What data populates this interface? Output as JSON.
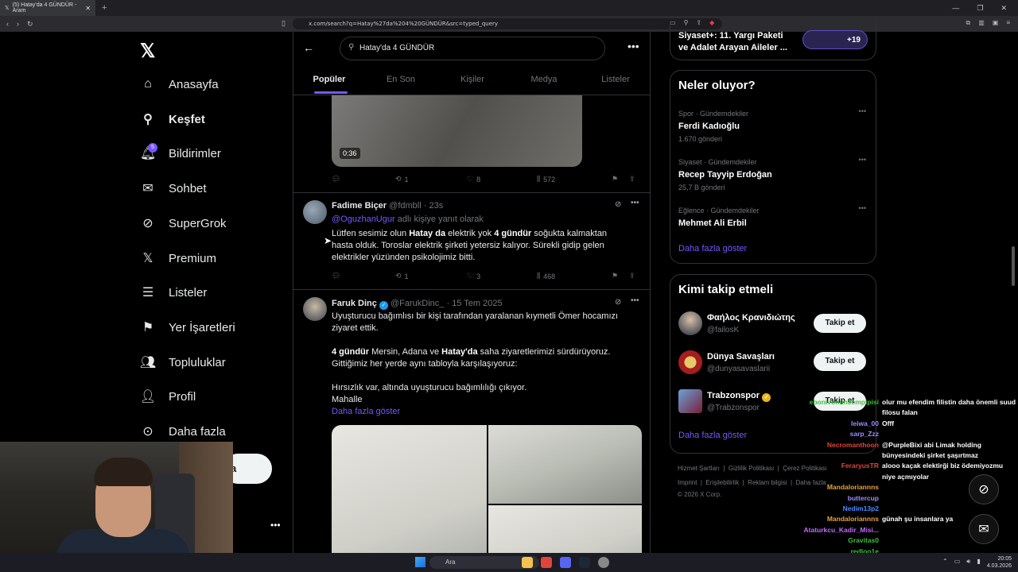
{
  "browser": {
    "tab_title": "(5) Hatay'da 4 GÜNDÜR - Aram",
    "url": "x.com/search?q=Hatay%27da%204%20GÜNDÜR&src=typed_query"
  },
  "nav": {
    "items": [
      {
        "label": "Anasayfa",
        "icon": "home-icon"
      },
      {
        "label": "Keşfet",
        "icon": "search-icon"
      },
      {
        "label": "Bildirimler",
        "icon": "bell-icon"
      },
      {
        "label": "Sohbet",
        "icon": "mail-icon"
      },
      {
        "label": "SuperGrok",
        "icon": "grok-icon"
      },
      {
        "label": "Premium",
        "icon": "x-icon"
      },
      {
        "label": "Listeler",
        "icon": "list-icon"
      },
      {
        "label": "Yer İşaretleri",
        "icon": "bookmark-icon"
      },
      {
        "label": "Topluluklar",
        "icon": "people-icon"
      },
      {
        "label": "Profil",
        "icon": "person-icon"
      },
      {
        "label": "Daha fazla",
        "icon": "more-icon"
      }
    ],
    "notif_badge": "5",
    "post_btn_fragment": "a"
  },
  "search": {
    "query": "Hatay'da 4 GÜNDÜR",
    "tabs": [
      "Popüler",
      "En Son",
      "Kişiler",
      "Medya",
      "Listeler"
    ]
  },
  "tweet1": {
    "video_duration": "0:36",
    "retweets": "1",
    "likes": "8",
    "views": "572"
  },
  "tweet2": {
    "name": "Fadime Biçer",
    "handle": "@fdmbll",
    "time": "· 23s",
    "reply_to": "@OguzhanUgur",
    "reply_suffix": " adlı kişiye yanıt olarak",
    "text_a": "Lütfen sesimiz olun ",
    "text_b": "Hatay da",
    "text_c": " elektrik yok ",
    "text_d": "4 gündür",
    "text_e": " soğukta kalmaktan hasta olduk. Toroslar elektrik şirketi yetersiz kalıyor. Sürekli gidip gelen elektrikler yüzünden psikolojimiz bitti.",
    "retweets": "1",
    "likes": "3",
    "views": "468"
  },
  "tweet3": {
    "name": "Faruk Dinç",
    "handle": "@FarukDinc_",
    "time": "· 15 Tem 2025",
    "p1": "Uyuşturucu bağımlısı bir kişi tarafından yaralanan kıymetli Ömer hocamızı ziyaret ettik.",
    "p2_bold1": "4 gündür",
    "p2_mid": " Mersin, Adana ve ",
    "p2_bold2": "Hatay'da",
    "p2_end": " saha ziyaretlerimizi sürdürüyoruz.",
    "p3": "Gittiğimiz her yerde aynı tabloyla karşılaşıyoruz:",
    "p4": "Hırsızlık var, altında uyuşturucu bağımlılığı çıkıyor.",
    "p5": "Mahalle",
    "show_more": "Daha fazla göster"
  },
  "sidebar": {
    "top_card_line1": "Siyaset+: 11. Yargı Paketi",
    "top_card_line2": "ve Adalet Arayan Aileler ...",
    "top_card_count": "+19",
    "trends_title": "Neler oluyor?",
    "trends": [
      {
        "category": "Spor · Gündemdekiler",
        "name": "Ferdi Kadıoğlu",
        "count": "1.670 gönderi"
      },
      {
        "category": "Siyaset · Gündemdekiler",
        "name": "Recep Tayyip Erdoğan",
        "count": "25,7 B gönderi"
      },
      {
        "category": "Eğlence · Gündemdekiler",
        "name": "Mehmet Ali Erbil",
        "count": ""
      }
    ],
    "show_more": "Daha fazla göster",
    "follow_title": "Kimi takip etmeli",
    "follow": [
      {
        "name": "Φαήλος Κρανιδιώτης",
        "handle": "@failosK",
        "btn": "Takip et"
      },
      {
        "name": "Dünya Savaşları",
        "handle": "@dunyasavaslarii",
        "btn": "Takip et"
      },
      {
        "name": "Trabzonspor",
        "handle": "@Trabzonspor",
        "btn": "Takip et"
      }
    ],
    "follow_more": "Daha fazla göster",
    "footer_line1": [
      "Hizmet Şartları",
      "Gizlilik Politikası",
      "Çerez Politikası"
    ],
    "footer_line2": [
      "Imprint",
      "Erişilebilirlik",
      "Reklam bilgisi",
      "Daha fazla ..."
    ],
    "copyright": "© 2026 X Corp."
  },
  "chat": [
    {
      "user": "ebonivonun3cmpipisi",
      "color": "#3fbf3f",
      "msg": "olur mu efendim filistin daha önemli suud filosu falan"
    },
    {
      "user": "leiwa_00",
      "color": "#9b8cff",
      "msg": "Offf"
    },
    {
      "user": "sarp_Zzz",
      "color": "#9b8cff",
      "msg": ""
    },
    {
      "user": "Necromanthoon",
      "color": "#e0443a",
      "msg": "@PurpleBixi abi Limak holding bünyesindeki şirket şaşırtmaz"
    },
    {
      "user": "FeraryusTR",
      "color": "#e0443a",
      "msg": "alooo kaçak elektirği biz ödemiyozmu niye açmıyolar"
    },
    {
      "user": "Mandaloriannns",
      "color": "#e8a13a",
      "msg": ""
    },
    {
      "user": "buttercup",
      "color": "#9b8cff",
      "msg": ""
    },
    {
      "user": "Nedim13p2",
      "color": "#4b8cff",
      "msg": ""
    },
    {
      "user": "Mandaloriannns",
      "color": "#e8a13a",
      "msg": "günah şu insanlara ya"
    },
    {
      "user": "Ataturkcu_Kadir_Misi...",
      "color": "#c06cff",
      "msg": ""
    },
    {
      "user": "Gravitas0",
      "color": "#3fbf3f",
      "msg": ""
    },
    {
      "user": "redloo1e",
      "color": "#3fbf3f",
      "msg": ""
    }
  ],
  "taskbar": {
    "search": "Ara",
    "time": "20:05",
    "date": "4.03.2026"
  }
}
